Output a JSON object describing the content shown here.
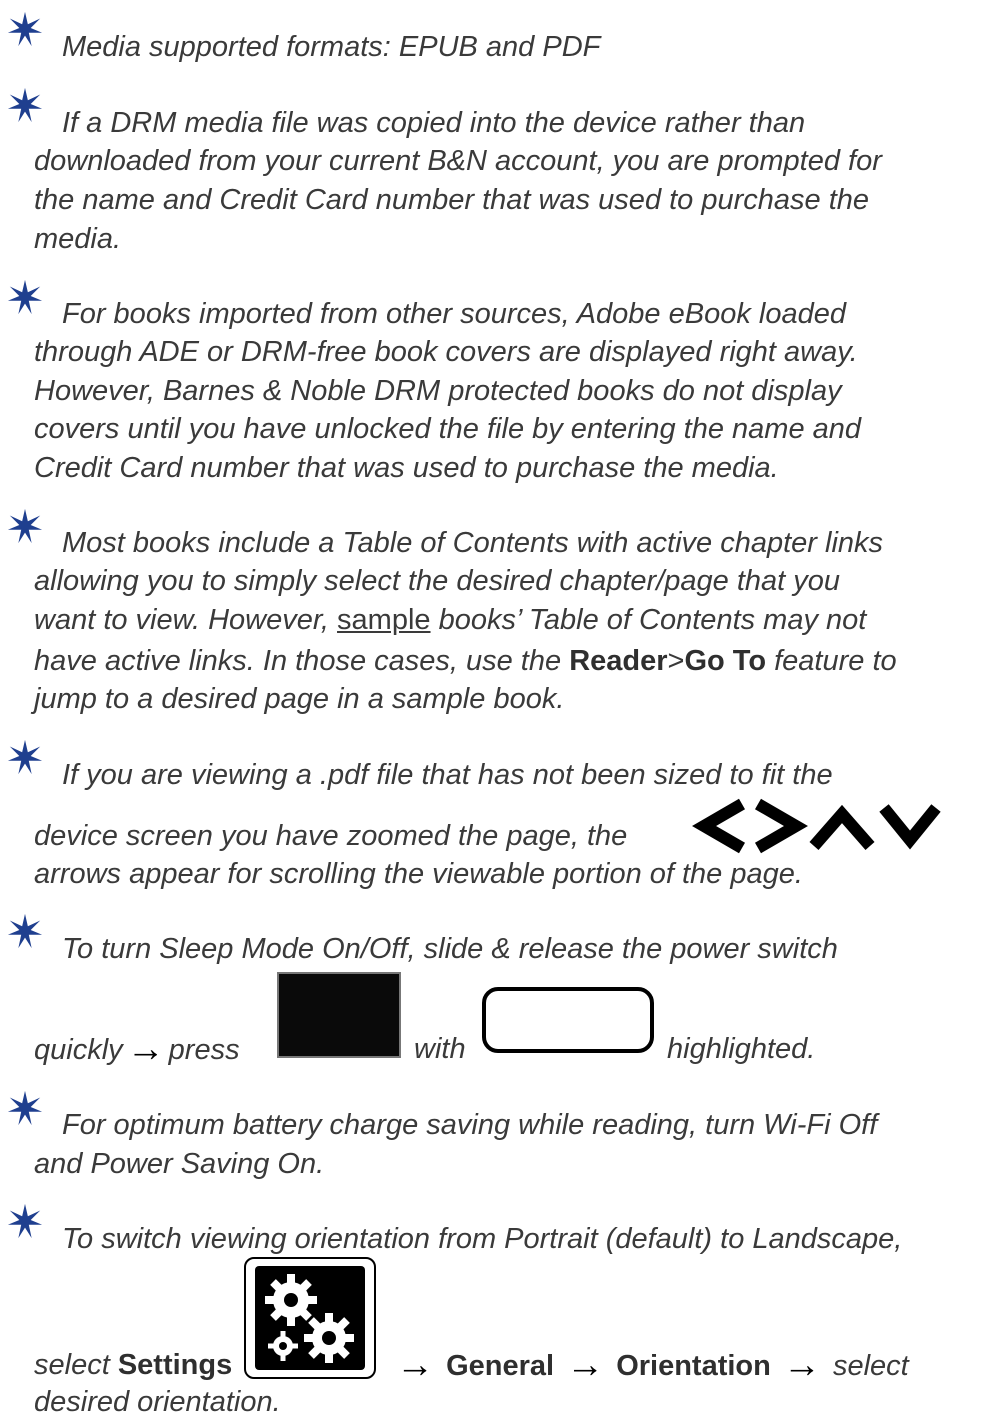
{
  "bullets": [
    {
      "lines": [
        "Media supported formats: EPUB and PDF"
      ]
    },
    {
      "lines": [
        "If a DRM media file was copied into the device rather than",
        "downloaded from your current B&N account, you are prompted for",
        "the name and Credit Card number that was used to purchase the",
        "media."
      ]
    },
    {
      "lines": [
        "For books imported from other sources, Adobe eBook loaded",
        "through ADE or DRM-free book covers are displayed right away.",
        "However, Barnes & Noble DRM protected books do not display",
        "covers until you have unlocked the file by entering the name and",
        "Credit Card number that was used to purchase the media."
      ]
    },
    {
      "lines": [
        "Most books include a Table of Contents with active chapter links",
        "allowing you to simply select the desired chapter/page that you"
      ],
      "line3_a": "want to view. However, ",
      "line3_u": "sample",
      "line3_b": " books’ Table of Contents may not",
      "line4_a": "have active links. In those cases, use the ",
      "line4_bold1": "Reader",
      "line4_sep": ">",
      "line4_bold2": "Go To",
      "line4_b": " feature to",
      "line5": "jump to a desired page in a sample book."
    },
    {
      "line1": "If you are viewing a .pdf file that has not been sized to fit the",
      "line2": "device screen you have zoomed the page, the",
      "line3": "arrows appear for scrolling the viewable portion of the page."
    },
    {
      "line1": "To turn Sleep Mode On/Off, slide & release the power switch",
      "quickly": "quickly",
      "press": "press",
      "with": "with",
      "highlighted": "highlighted."
    },
    {
      "lines": [
        "For optimum battery charge saving while reading, turn Wi-Fi Off",
        "and Power Saving On."
      ]
    },
    {
      "line1": "To switch viewing orientation from Portrait (default) to Landscape,",
      "select": "select ",
      "settings": "Settings",
      "general": "General",
      "orientation": "Orientation",
      "select2": "select",
      "line3": "desired orientation."
    }
  ],
  "icons": {
    "star": "star-icon",
    "arrow": "right-arrow-icon",
    "nav": [
      "left-chevron-icon",
      "right-chevron-icon",
      "up-chevron-icon",
      "down-chevron-icon"
    ],
    "sleep_button": "black-button-icon",
    "moon_button": "moon-icon",
    "settings": "gears-icon"
  },
  "colors": {
    "star": "#1f3f8f",
    "text": "#3a3a3a"
  }
}
